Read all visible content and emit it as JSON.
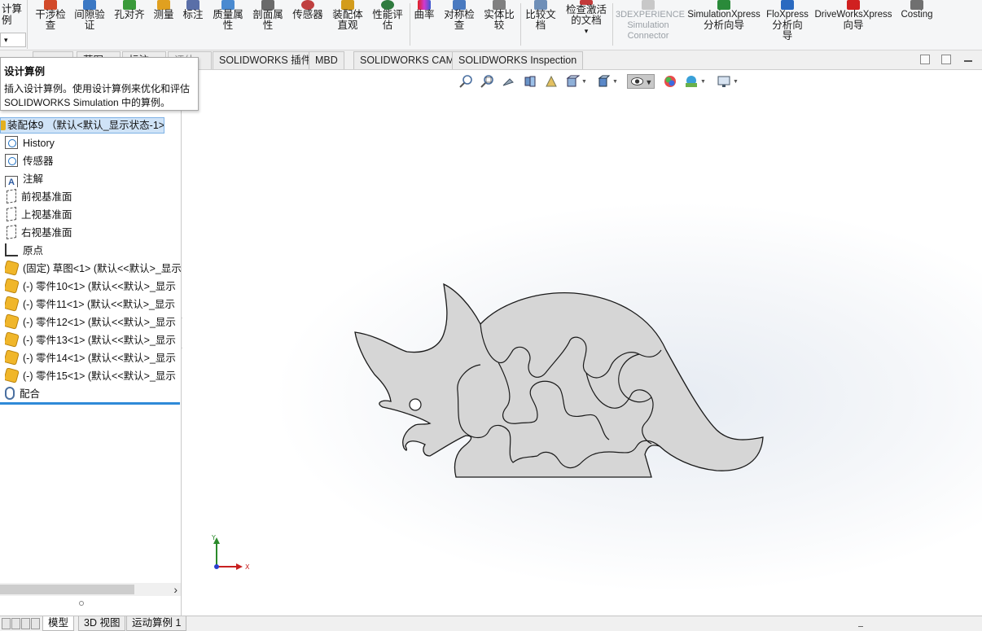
{
  "ribbon": {
    "first_label_line1": "计算",
    "first_label_line2": "例",
    "first_dropdown": "▾",
    "tools": [
      {
        "line1": "干涉检",
        "line2": "查",
        "icon_color": "#d24a2a"
      },
      {
        "line1": "间隙验",
        "line2": "证",
        "icon_color": "#3b78c4"
      },
      {
        "line1": "孔对齐",
        "line2": "",
        "icon_color": "#3a9a3a"
      },
      {
        "line1": "测量",
        "line2": "",
        "icon_color": "#e0a020"
      },
      {
        "line1": "标注",
        "line2": "",
        "icon_color": "#5a6fa8"
      },
      {
        "line1": "质量属",
        "line2": "性",
        "icon_color": "#4a8ad0"
      },
      {
        "line1": "剖面属",
        "line2": "性",
        "icon_color": "#6a6a6a"
      },
      {
        "line1": "传感器",
        "line2": "",
        "icon_color": "#c04040"
      },
      {
        "line1": "装配体",
        "line2": "直观",
        "icon_color": "#d39c1c"
      },
      {
        "line1": "性能评",
        "line2": "估",
        "icon_color": "#2f7b3f"
      },
      {
        "line1": "曲率",
        "line2": "",
        "icon_color": "#d03ad0"
      },
      {
        "line1": "对称检",
        "line2": "查",
        "icon_color": "#4a7ac0"
      },
      {
        "line1": "实体比",
        "line2": "较",
        "icon_color": "#808080"
      },
      {
        "line1": "比较文",
        "line2": "档",
        "icon_color": "#6f8fb8"
      },
      {
        "line1": "检查激活",
        "line2": "的文档",
        "icon_color": "#c33a3a"
      }
    ],
    "more_dropdown": "▾",
    "connector": {
      "line1": "3DEXPERIENCE",
      "line2": "Simulation",
      "line3": "Connector"
    },
    "addins": [
      {
        "line1": "SimulationXpress",
        "line2": "分析向导",
        "line3": "",
        "icon_color": "#2a8a3a"
      },
      {
        "line1": "FloXpress",
        "line2": "分析向",
        "line3": "导",
        "icon_color": "#2a6ac0"
      },
      {
        "line1": "DriveWorksXpress",
        "line2": "向导",
        "line3": "",
        "icon_color": "#d02020"
      },
      {
        "line1": "Costing",
        "line2": "",
        "line3": "",
        "icon_color": "#707070"
      }
    ]
  },
  "tabs": {
    "partial": [
      {
        "label": "评估"
      },
      {
        "label": "草图"
      },
      {
        "label": "标注"
      },
      {
        "label": "评估"
      }
    ],
    "visible": [
      {
        "label": "SOLIDWORKS 插件"
      },
      {
        "label": "MBD"
      },
      {
        "label": "SOLIDWORKS CAM"
      },
      {
        "label": "SOLIDWORKS Inspection"
      }
    ]
  },
  "tooltip": {
    "title": "设计算例",
    "line1": "插入设计算例。使用设计算例来优化和评估",
    "line2": "SOLIDWORKS Simulation 中的算例。"
  },
  "tree": {
    "root": "装配体9 （默认<默认_显示状态-1>)",
    "items": [
      {
        "label": "History",
        "icon": "history-icon"
      },
      {
        "label": "传感器",
        "icon": "sensor-icon"
      },
      {
        "label": "注解",
        "icon": "annotation-icon"
      },
      {
        "label": "前视基准面",
        "icon": "plane-icon"
      },
      {
        "label": "上视基准面",
        "icon": "plane-icon"
      },
      {
        "label": "右视基准面",
        "icon": "plane-icon"
      },
      {
        "label": "原点",
        "icon": "origin-icon"
      },
      {
        "label": "(固定) 草图<1> (默认<<默认>_显示",
        "icon": "part-icon"
      },
      {
        "label": "(-) 零件10<1> (默认<<默认>_显示",
        "icon": "part-icon"
      },
      {
        "label": "(-) 零件11<1> (默认<<默认>_显示",
        "icon": "part-icon"
      },
      {
        "label": "(-) 零件12<1> (默认<<默认>_显示",
        "icon": "part-icon"
      },
      {
        "label": "(-) 零件13<1> (默认<<默认>_显示",
        "icon": "part-icon"
      },
      {
        "label": "(-) 零件14<1> (默认<<默认>_显示",
        "icon": "part-icon"
      },
      {
        "label": "(-) 零件15<1> (默认<<默认>_显示",
        "icon": "part-icon"
      },
      {
        "label": "配合",
        "icon": "mate-icon"
      }
    ],
    "scroll_right": "›"
  },
  "triad": {
    "y_label": "Y",
    "x_label": "X"
  },
  "bottom_tabs": [
    {
      "label": "模型",
      "active": true
    },
    {
      "label": "3D 视图",
      "active": false
    },
    {
      "label": "运动算例 1",
      "active": false
    }
  ],
  "colors": {
    "selection_bg": "#cfe3f7",
    "selection_border": "#7fb2e5",
    "accent_line": "#2f8ad8",
    "part_fill": "#d6d6d6",
    "part_outline": "#1a1a1a"
  }
}
